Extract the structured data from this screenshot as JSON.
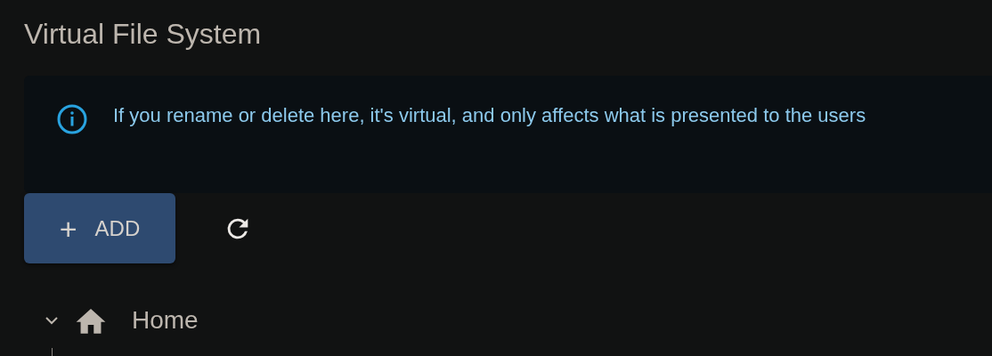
{
  "page": {
    "title": "Virtual File System"
  },
  "alert": {
    "message": "If you rename or delete here, it's virtual, and only affects what is presented to the users"
  },
  "toolbar": {
    "add_button": {
      "icon": "+",
      "label": "ADD"
    }
  },
  "tree": [
    {
      "label": "Home",
      "expanded": true
    }
  ]
}
